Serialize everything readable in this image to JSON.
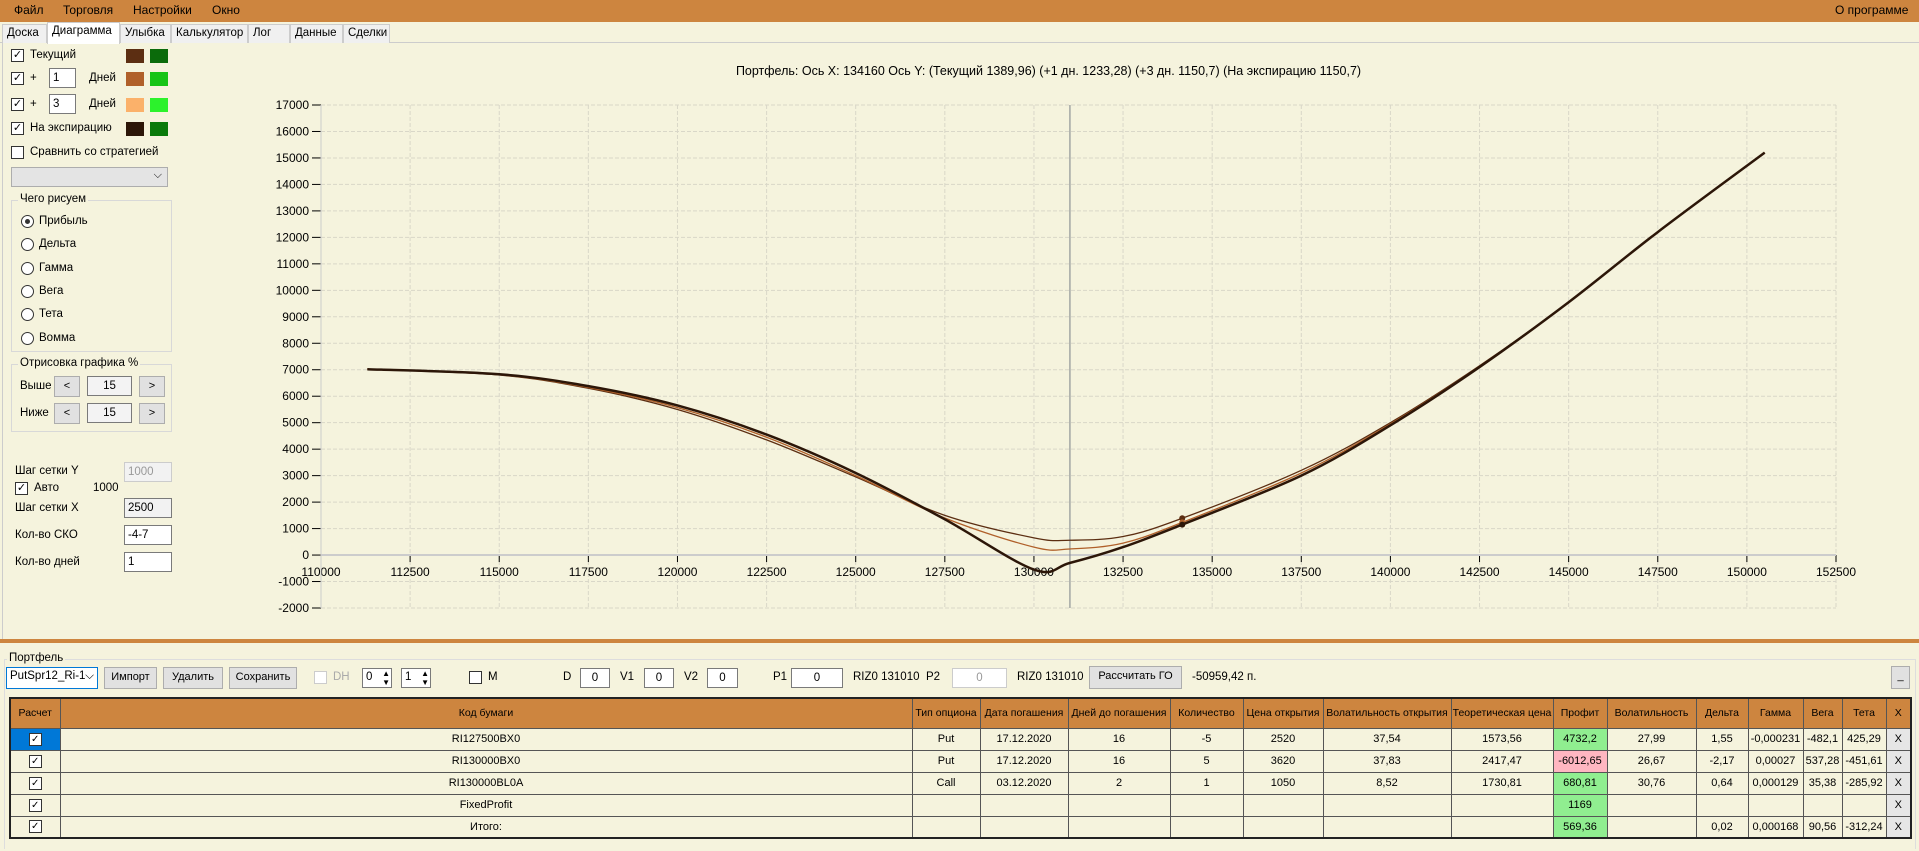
{
  "menu": {
    "file": "Файл",
    "trade": "Торговля",
    "settings": "Настройки",
    "window": "Окно",
    "about": "О программе"
  },
  "tabs": [
    "Доска",
    "Диаграмма",
    "Улыбка",
    "Калькулятор",
    "Лог",
    "Данные",
    "Сделки"
  ],
  "left": {
    "current": "Текущий",
    "plus": "+",
    "days": "Дней",
    "days1": "1",
    "days3": "3",
    "expiration": "На экспирацию",
    "compare": "Сравнить со стратегией",
    "colors": {
      "current": [
        "#5c2e12",
        "#0b6b0b"
      ],
      "d1": [
        "#b0602a",
        "#17c417"
      ],
      "d3": [
        "#fbb16a",
        "#2cf22c"
      ],
      "exp": [
        "#2c1608",
        "#0a7a0a"
      ]
    },
    "draw_group": "Чего рисуем",
    "radios": [
      "Прибыль",
      "Дельта",
      "Гамма",
      "Вега",
      "Тета",
      "Вомма"
    ],
    "selected_radio": 0,
    "render_group": "Отрисовка графика %",
    "above": "Выше",
    "below": "Ниже",
    "above_val": "15",
    "below_val": "15",
    "lt": "<",
    "gt": ">",
    "grid_y": "Шаг сетки Y",
    "grid_y_val": "1000",
    "auto": "Авто",
    "auto_val": "1000",
    "grid_x": "Шаг сетки X",
    "grid_x_val": "2500",
    "sko": "Кол-во СКО",
    "sko_val": "-4-7",
    "ndays": "Кол-во дней",
    "ndays_val": "1"
  },
  "chart_data": {
    "type": "line",
    "title": "Портфель: Ось X: 134160 Ось Y:  (Текущий 1389,96)  (+1 дн. 1233,28)  (+3 дн. 1150,7)  (На экспирацию 1150,7)",
    "xlim": [
      110000,
      152500
    ],
    "ylim": [
      -2000,
      17000
    ],
    "xstep": 2500,
    "ystep": 1000,
    "xticks": [
      "110000",
      "112500",
      "115000",
      "117500",
      "120000",
      "122500",
      "125000",
      "127500",
      "130000",
      "132500",
      "135000",
      "137500",
      "140000",
      "142500",
      "145000",
      "147500",
      "150000",
      "152500"
    ],
    "yticks": [
      "17000",
      "16000",
      "15000",
      "14000",
      "13000",
      "12000",
      "11000",
      "10000",
      "9000",
      "8000",
      "7000",
      "6000",
      "5000",
      "4000",
      "3000",
      "2000",
      "1000",
      "0",
      "-1000",
      "-2000"
    ],
    "cursor_x": 131010,
    "marker_x": 134160,
    "x": [
      111300,
      115000,
      117500,
      120000,
      122500,
      125000,
      127500,
      130000,
      131000,
      132500,
      134160,
      137500,
      140000,
      142500,
      145000,
      147500,
      150500
    ],
    "series": [
      {
        "name": "Текущий",
        "color": "#5c2e12",
        "values": [
          7020,
          6800,
          6300,
          5500,
          4350,
          2950,
          1500,
          650,
          560,
          700,
          1390,
          3200,
          5000,
          7150,
          9550,
          12200,
          15200
        ]
      },
      {
        "name": "+1 дн.",
        "color": "#b0602a",
        "values": [
          7020,
          6810,
          6330,
          5570,
          4450,
          3000,
          1400,
          300,
          230,
          450,
          1233,
          3100,
          4950,
          7120,
          9550,
          12200,
          15200
        ]
      },
      {
        "name": "+3 дн.",
        "color": "#fbb16a",
        "values": [
          7020,
          6830,
          6380,
          5650,
          4550,
          3100,
          1350,
          -550,
          -300,
          300,
          1151,
          3000,
          4900,
          7100,
          9550,
          12200,
          15200
        ]
      },
      {
        "name": "На экспирацию",
        "color": "#2c1608",
        "values": [
          7020,
          6830,
          6380,
          5650,
          4550,
          3100,
          1350,
          -550,
          -300,
          300,
          1151,
          3000,
          4900,
          7100,
          9550,
          12200,
          15200
        ]
      }
    ]
  },
  "portfolio": {
    "label": "Портфель",
    "combo": "PutSpr12_Ri-1",
    "import": "Импорт",
    "delete": "Удалить",
    "save": "Сохранить",
    "dh": "DH",
    "spin0": "0",
    "spin1": "1",
    "m": "M",
    "d": "D",
    "d_val": "0",
    "v1": "V1",
    "v1_val": "0",
    "v2": "V2",
    "v2_val": "0",
    "p1": "P1",
    "p1_val": "0",
    "riz1": "RIZ0 131010",
    "p2": "P2",
    "p2_val": "0",
    "riz2": "RIZ0 131010",
    "calc_go": "Рассчитать ГО",
    "go_val": "-50959,42 п.",
    "min": "_"
  },
  "table": {
    "headers": [
      "Расчет",
      "Код бумаги",
      "Тип опциона",
      "Дата погашения",
      "Дней до погашения",
      "Количество",
      "Цена открытия",
      "Волатильность открытия",
      "Теоретическая цена",
      "Профит",
      "Волатильность",
      "Дельта",
      "Гамма",
      "Вега",
      "Тета",
      "X"
    ],
    "rows": [
      [
        "RI127500BX0",
        "Put",
        "17.12.2020",
        "16",
        "-5",
        "2520",
        "37,54",
        "1573,56",
        "4732,2",
        "27,99",
        "1,55",
        "-0,000231",
        "-482,1",
        "425,29",
        "X"
      ],
      [
        "RI130000BX0",
        "Put",
        "17.12.2020",
        "16",
        "5",
        "3620",
        "37,83",
        "2417,47",
        "-6012,65",
        "26,67",
        "-2,17",
        "0,00027",
        "537,28",
        "-451,61",
        "X"
      ],
      [
        "RI130000BL0A",
        "Call",
        "03.12.2020",
        "2",
        "1",
        "1050",
        "8,52",
        "1730,81",
        "680,81",
        "30,76",
        "0,64",
        "0,000129",
        "35,38",
        "-285,92",
        "X"
      ],
      [
        "FixedProfit",
        "",
        "",
        "",
        "",
        "",
        "",
        "",
        "1169",
        "",
        "",
        "",
        "",
        "",
        "X"
      ],
      [
        "Итого:",
        "",
        "",
        "",
        "",
        "",
        "",
        "",
        "569,36",
        "",
        "0,02",
        "0,000168",
        "90,56",
        "-312,24",
        "X"
      ]
    ]
  }
}
